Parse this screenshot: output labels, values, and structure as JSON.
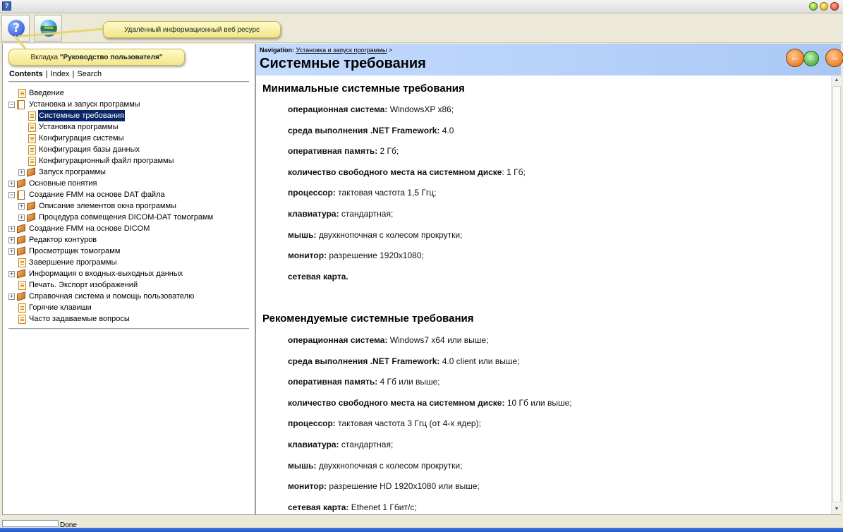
{
  "window": {
    "icon_glyph": "?"
  },
  "toolbar": {
    "help_button": {
      "icon": "help-icon",
      "glyph": "?"
    },
    "web_button": {
      "icon": "globe-icon",
      "glyph": "www"
    }
  },
  "callouts": {
    "web_resource": "Удалённый информационный веб ресурс",
    "tab_prefix": "Вкладка ",
    "tab_name": "\"Руководство пользователя\""
  },
  "left_tabs": {
    "contents": "Contents",
    "sep1": "|",
    "index": "Index",
    "sep2": "|",
    "search": "Search"
  },
  "tree": [
    {
      "label": "Введение",
      "icon": "page-icon",
      "expander": ""
    },
    {
      "label": "Установка и запуск программы",
      "icon": "open-book-icon",
      "expander": "−"
    },
    {
      "label": "Системные требования",
      "icon": "page-icon",
      "expander": "",
      "selected": true
    },
    {
      "label": "Установка программы",
      "icon": "page-icon",
      "expander": ""
    },
    {
      "label": "Конфигурация системы",
      "icon": "page-icon",
      "expander": ""
    },
    {
      "label": "Конфигурация базы данных",
      "icon": "page-icon",
      "expander": ""
    },
    {
      "label": "Конфигурационный файл программы",
      "icon": "page-icon",
      "expander": ""
    },
    {
      "label": "Запуск программы",
      "icon": "book-icon",
      "expander": "+"
    },
    {
      "label": "Основные понятия",
      "icon": "book-icon",
      "expander": "+"
    },
    {
      "label": "Создание FMM на основе DAT файла",
      "icon": "open-book-icon",
      "expander": "−"
    },
    {
      "label": "Описание элементов окна программы",
      "icon": "book-icon",
      "expander": "+"
    },
    {
      "label": "Процедура совмещения DICOM-DAT томограмм",
      "icon": "book-icon",
      "expander": "+"
    },
    {
      "label": "Создание FMM на основе DICOM",
      "icon": "book-icon",
      "expander": "+"
    },
    {
      "label": "Редактор контуров",
      "icon": "book-icon",
      "expander": "+"
    },
    {
      "label": "Просмотрщик томограмм",
      "icon": "book-icon",
      "expander": "+"
    },
    {
      "label": "Завершение программы",
      "icon": "page-icon",
      "expander": ""
    },
    {
      "label": "Информация о входных-выходных данных",
      "icon": "book-icon",
      "expander": "+"
    },
    {
      "label": "Печать. Экспорт изображений",
      "icon": "page-icon",
      "expander": ""
    },
    {
      "label": "Справочная система и помощь пользователю",
      "icon": "book-icon",
      "expander": "+"
    },
    {
      "label": "Горячие клавиши",
      "icon": "page-icon",
      "expander": ""
    },
    {
      "label": "Часто задаваемые вопросы",
      "icon": "page-icon",
      "expander": ""
    }
  ],
  "header": {
    "nav_label": "Navigation:",
    "nav_link": "Установка и запуск программы",
    "nav_sep": ">",
    "title": "Системные требования",
    "prev_glyph": "←",
    "up_glyph": "⌂",
    "next_glyph": "→"
  },
  "content": {
    "min_heading": "Минимальные системные требования",
    "min": [
      {
        "k": "операционная система:",
        "v": " WindowsXP x86;"
      },
      {
        "k": "среда выполнения .NET Framework:",
        "v": " 4.0"
      },
      {
        "k": "оперативная память:",
        "v": " 2 Гб;"
      },
      {
        "k": "количество свободного места на системном диске",
        "v": ": 1 Гб;"
      },
      {
        "k": "процессор:",
        "v": " тактовая частота 1,5 Ггц;"
      },
      {
        "k": "клавиатура:",
        "v": " стандартная;"
      },
      {
        "k": "мышь:",
        "v": " двухкнопочная с колесом прокрутки;"
      },
      {
        "k": "монитор:",
        "v": " разрешение 1920x1080;"
      },
      {
        "k": "сетевая карта.",
        "v": ""
      }
    ],
    "rec_heading": "Рекомендуемые системные требования",
    "rec": [
      {
        "k": "операционная система:",
        "v": " Windows7 x64 или выше;"
      },
      {
        "k": "среда выполнения .NET Framework:",
        "v": " 4.0 client  или выше;"
      },
      {
        "k": "оперативная память:",
        "v": " 4 Гб или выше;"
      },
      {
        "k": "количество свободного места на системном диске:",
        "v": "  10 Гб или выше;"
      },
      {
        "k": "процессор:",
        "v": " тактовая частота 3 Ггц (от 4-х ядер);"
      },
      {
        "k": "клавиатура:",
        "v": " стандартная;"
      },
      {
        "k": "мышь:",
        "v": " двухкнопочная с колесом прокрутки;"
      },
      {
        "k": "монитор:",
        "v": " разрешение HD 1920x1080 или выше;"
      },
      {
        "k": "сетевая карта:",
        "v": " Ethenet 1 Гбит/с;"
      }
    ]
  },
  "scrollbar": {
    "up_glyph": "▲",
    "down_glyph": "▼"
  },
  "status": {
    "text": "Done"
  }
}
